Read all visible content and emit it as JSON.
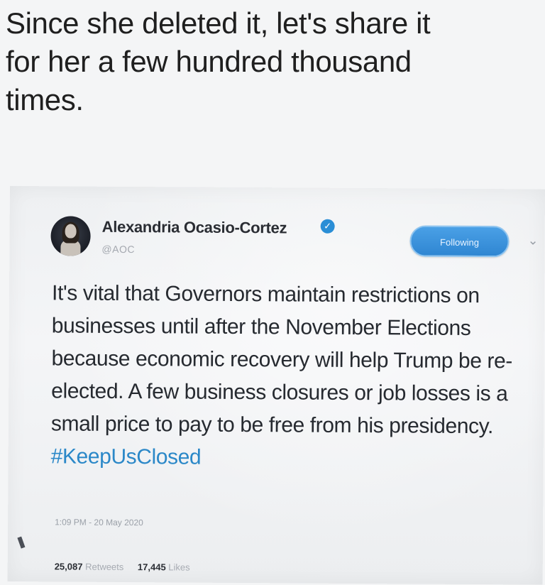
{
  "caption": {
    "line1": "Since she deleted it, let's share it",
    "line2": "for her a few hundred thousand",
    "line3": "times."
  },
  "tweet": {
    "author_name": "Alexandria Ocasio-Cortez",
    "handle": "@AOC",
    "follow_label": "Following",
    "text_main": "It's vital that Governors maintain restrictions on businesses until after the November Elections because economic recovery will help Trump be re-elected. A few business closures or job losses is a small price to pay to be free from his presidency. ",
    "hashtag": "#KeepUsClosed",
    "timestamp": "1:09 PM - 20 May 2020",
    "retweets_count": "25,087",
    "retweets_label": "Retweets",
    "likes_count": "17,445",
    "likes_label": "Likes"
  },
  "icons": {
    "verified": "verified-badge-icon",
    "chevron": "chevron-down-icon",
    "avatar": "profile-avatar"
  },
  "colors": {
    "accent": "#2f86d2",
    "hashtag": "#2b88c8",
    "verified": "#2a8ed6"
  }
}
